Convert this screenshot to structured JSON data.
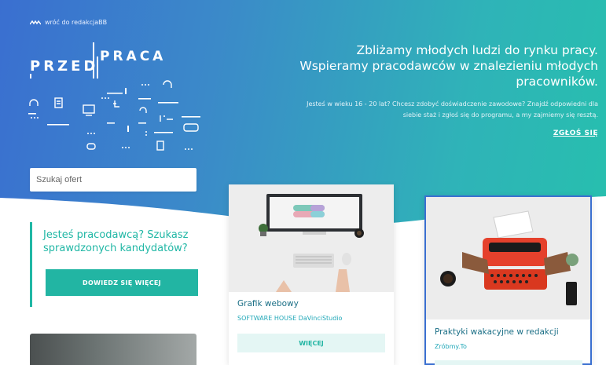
{
  "header": {
    "back_link": "wróć do redakcjaBB",
    "logo_left": "PRZED",
    "logo_right": "PRACA",
    "headline": "Zbliżamy młodych ludzi do rynku pracy. Wspieramy pracodawców w znalezieniu młodych pracowników.",
    "subline": "Jesteś w wieku 16 - 20 lat? Chcesz zdobyć doświadczenie zawodowe? Znajdź odpowiedni dla siebie staż i zgłoś się do programu, a my zajmiemy się resztą.",
    "apply_label": "ZGŁOŚ SIĘ"
  },
  "search": {
    "placeholder": "Szukaj ofert"
  },
  "employer": {
    "heading": "Jesteś pracodawcą? Szukasz sprawdzonych kandydatów?",
    "button_label": "DOWIEDZ SIĘ WIĘCEJ"
  },
  "offers": [
    {
      "title": "Grafik webowy",
      "company": "SOFTWARE HOUSE DaVinciStudio",
      "button_label": "WIĘCEJ"
    },
    {
      "title": "Praktyki wakacyjne w redakcji",
      "company": "Zróbmy.To",
      "button_label": ""
    }
  ],
  "colors": {
    "hero_start": "#3a6fd0",
    "hero_end": "#27bfae",
    "accent": "#22b5a3",
    "title_blue": "#1b6f86"
  }
}
